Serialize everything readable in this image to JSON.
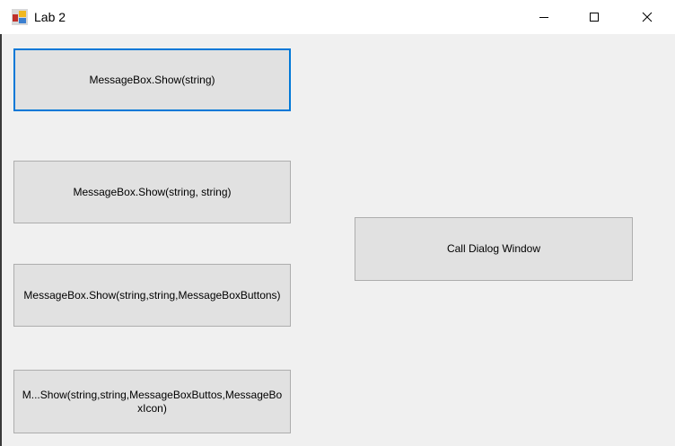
{
  "window": {
    "title": "Lab  2",
    "icon": "winforms-app-icon"
  },
  "controls": {
    "minimize": "minimize-icon",
    "maximize": "maximize-icon",
    "close": "close-icon"
  },
  "buttons": {
    "show_string": "MessageBox.Show(string)",
    "show_string_string": "MessageBox.Show(string, string)",
    "show_buttons": "MessageBox.Show(string,string,MessageBoxButtons)",
    "show_icon": "M...Show(string,string,MessageBoxButtos,MessageBoxIcon)",
    "call_dialog": "Call Dialog Window"
  },
  "colors": {
    "focus": "#0078d7",
    "button": "#e1e1e1",
    "background": "#f0f0f0"
  }
}
